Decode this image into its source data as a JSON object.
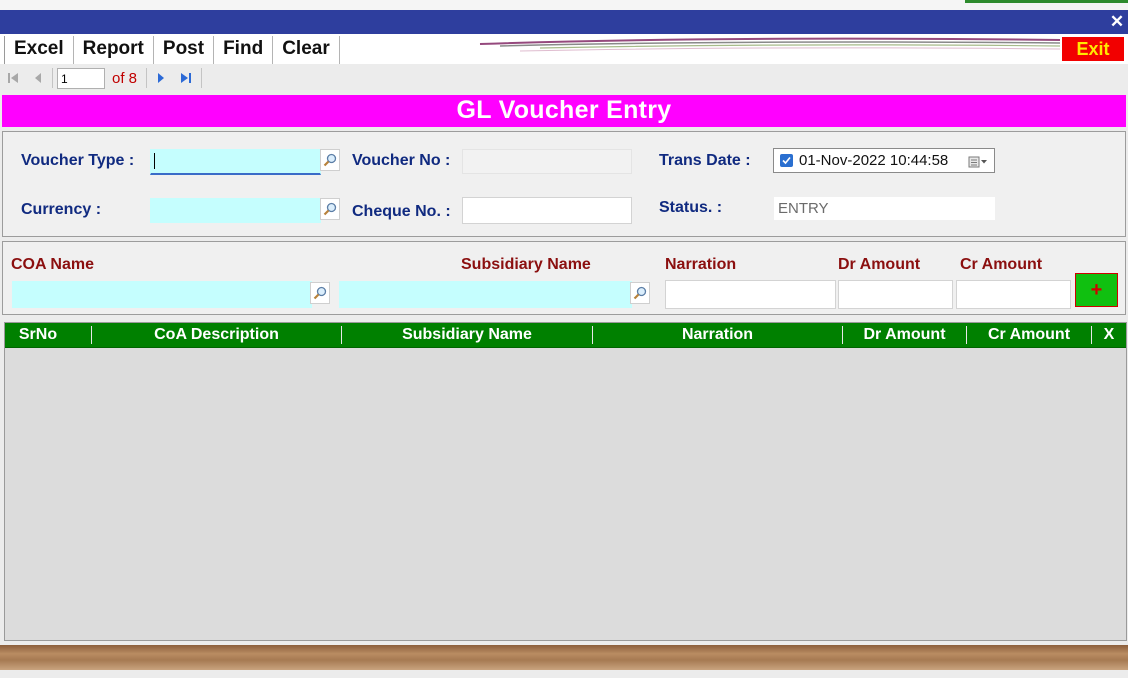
{
  "window": {
    "close_glyph": "✕"
  },
  "menu": {
    "items": [
      "Excel",
      "Report",
      "Post",
      "Find",
      "Clear"
    ],
    "exit_label": "Exit"
  },
  "navigator": {
    "page": "1",
    "of_label": "of 8"
  },
  "form": {
    "title": "GL Voucher Entry",
    "voucher_type_label": "Voucher Type :",
    "voucher_no_label": "Voucher No :",
    "trans_date_label": "Trans Date :",
    "trans_date_value": "01-Nov-2022 10:44:58",
    "currency_label": "Currency :",
    "cheque_no_label": "Cheque No. :",
    "status_label": "Status. :",
    "status_value": "ENTRY"
  },
  "entry": {
    "coa_name_label": "COA Name",
    "subsidiary_name_label": "Subsidiary Name",
    "narration_label": "Narration",
    "dr_amount_label": "Dr Amount",
    "cr_amount_label": "Cr Amount",
    "add_label": "+"
  },
  "grid": {
    "columns": [
      "SrNo",
      "CoA Description",
      "Subsidiary Name",
      "Narration",
      "Dr Amount",
      "Cr Amount",
      "X"
    ]
  },
  "colors": {
    "title_bar": "#2e3e9e",
    "heading_bg": "#ff00ff",
    "grid_header": "#008000",
    "exit_bg": "#f20000",
    "exit_text": "#ffe800",
    "label_blue": "#102a80",
    "label_red": "#8b0f0f",
    "lookup_field": "#c5fefe",
    "add_button": "#10c010"
  }
}
